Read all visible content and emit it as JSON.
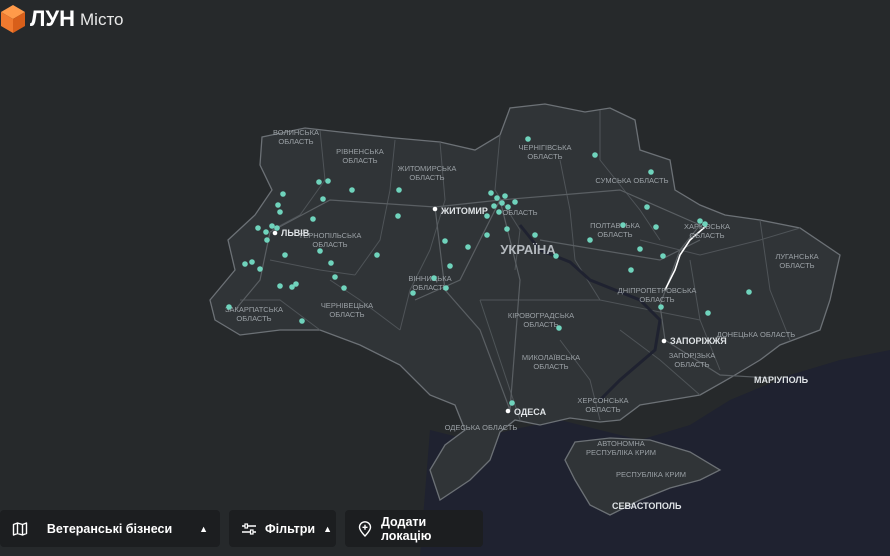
{
  "brand": {
    "name": "ЛУН",
    "sub": "Місто",
    "accent": "#f07a2f"
  },
  "toolbar": {
    "layers_label": "Ветеранські бізнеси",
    "filters_label": "Фільтри",
    "add_label": "Додати локацію"
  },
  "map": {
    "country_label": "УКРАЇНА",
    "marker_color": "#6fd3bc",
    "regions": [
      {
        "key": "volyn",
        "l1": "ВОЛИНСЬКА",
        "l2": "ОБЛАСТЬ"
      },
      {
        "key": "rivne",
        "l1": "РІВНЕНСЬКА",
        "l2": "ОБЛАСТЬ"
      },
      {
        "key": "zhytomyr",
        "l1": "ЖИТОМИРСЬКА",
        "l2": "ОБЛАСТЬ"
      },
      {
        "key": "chernihiv",
        "l1": "ЧЕРНІГІВСЬКА",
        "l2": "ОБЛАСТЬ"
      },
      {
        "key": "sumy",
        "l1": "СУМСЬКА ОБЛАСТЬ",
        "l2": ""
      },
      {
        "key": "kyiv",
        "l1": "ОБЛАСТЬ",
        "l2": ""
      },
      {
        "key": "poltava",
        "l1": "ПОЛТАВСЬКА",
        "l2": "ОБЛАСТЬ"
      },
      {
        "key": "kharkiv",
        "l1": "ХАРКІВСЬКА",
        "l2": "ОБЛАСТЬ"
      },
      {
        "key": "luhansk",
        "l1": "ЛУГАНСЬКА",
        "l2": "ОБЛАСТЬ"
      },
      {
        "key": "ternopil",
        "l1": "ТЕРНОПІЛЬСЬКА",
        "l2": "ОБЛАСТЬ"
      },
      {
        "key": "vinnytsia",
        "l1": "ВІННИЦЬКА",
        "l2": "ОБЛАСТЬ"
      },
      {
        "key": "dnipro",
        "l1": "ДНІПРОПЕТРОВСЬКА",
        "l2": "ОБЛАСТЬ"
      },
      {
        "key": "zakarpattia",
        "l1": "ЗАКАРПАТСЬКА",
        "l2": "ОБЛАСТЬ"
      },
      {
        "key": "chernivtsi",
        "l1": "ЧЕРНІВЕЦЬКА",
        "l2": "ОБЛАСТЬ"
      },
      {
        "key": "kirovohrad",
        "l1": "КІРОВОГРАДСЬКА",
        "l2": "ОБЛАСТЬ"
      },
      {
        "key": "donetsk",
        "l1": "ДОНЕЦЬКА ОБЛАСТЬ",
        "l2": ""
      },
      {
        "key": "mykolaiv",
        "l1": "МИКОЛАЇВСЬКА",
        "l2": "ОБЛАСТЬ"
      },
      {
        "key": "zaporizhzhia",
        "l1": "ЗАПОРІЗЬКА",
        "l2": "ОБЛАСТЬ"
      },
      {
        "key": "kherson",
        "l1": "ХЕРСОНСЬКА",
        "l2": "ОБЛАСТЬ"
      },
      {
        "key": "odesa",
        "l1": "ОДЕСЬКА ОБЛАСТЬ",
        "l2": ""
      },
      {
        "key": "crimea",
        "l1": "АВТОНОМНА",
        "l2": "РЕСПУБЛІКА КРИМ"
      },
      {
        "key": "crimea2",
        "l1": "РЕСПУБЛІКА КРИМ",
        "l2": ""
      }
    ],
    "cities": {
      "lviv": "ЛЬВІВ",
      "zhytomyr": "ЖИТОМИР",
      "zaporizhzhia": "ЗАПОРІЖЖЯ",
      "mariupol": "МАРІУПОЛЬ",
      "odesa": "ОДЕСА",
      "sevastopol": "СЕВАСТОПОЛЬ"
    }
  }
}
